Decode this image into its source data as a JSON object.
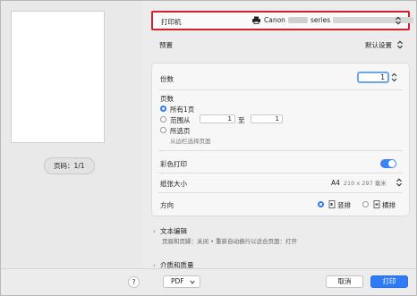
{
  "preview": {
    "page_badge": "页码：1/1"
  },
  "printer": {
    "label": "打印机",
    "brand": "Canon",
    "model_suffix": "series"
  },
  "preset": {
    "label": "预置",
    "value": "默认设置"
  },
  "copies": {
    "label": "份数",
    "value": "1"
  },
  "pages": {
    "label": "页数",
    "all": "所有1页",
    "range": "范围从",
    "range_from": "1",
    "range_to_label": "至",
    "range_to": "1",
    "selected": "所选页",
    "selected_hint": "从边栏选择页面"
  },
  "color": {
    "label": "彩色打印",
    "enabled": true
  },
  "paper": {
    "label": "纸张大小",
    "value": "A4",
    "dimensions": "210 x 297 毫米"
  },
  "orientation": {
    "label": "方向",
    "portrait": "竖排",
    "landscape": "横排",
    "selected": "portrait"
  },
  "sections": [
    {
      "title": "文本编辑",
      "desc": "页眉和页脚：关闭 • 重新自动换行以适合页面：打开"
    },
    {
      "title": "介质和质量",
      "desc": ""
    }
  ],
  "footer": {
    "help": "?",
    "pdf": "PDF",
    "cancel": "取消",
    "print": "打印"
  },
  "colors": {
    "accent": "#2f7bf5",
    "highlight_border": "#d4202c"
  }
}
